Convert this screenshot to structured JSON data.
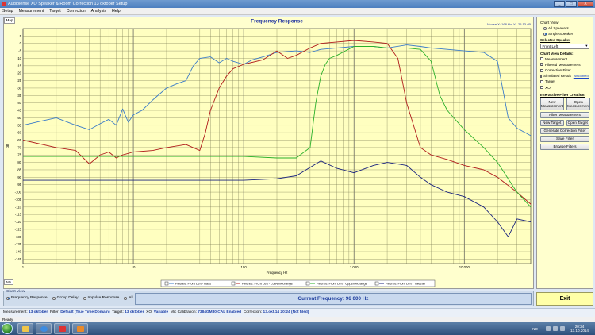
{
  "window": {
    "title": "Audiolense XO Speaker & Room Correction 13 oktober Setup",
    "controls": [
      "_",
      "□",
      "X"
    ]
  },
  "menu": [
    "Setup",
    "Measurement",
    "Target",
    "Correction",
    "Analysis",
    "Help"
  ],
  "map_tab": "Map",
  "mv_tab": "Mv",
  "chart": {
    "title": "Frequency Response",
    "mouse_readout": "Mouse X: 168 Hz,  Y: -25.13 dB",
    "legend": [
      {
        "label": "Filtered: Front Left - Bass",
        "color": "#3a7bc8"
      },
      {
        "label": "Filtered: Front Left - LowerMidrange",
        "color": "#b01c1c"
      },
      {
        "label": "Filtered: Front Left - UpperMidrange",
        "color": "#2ab02a"
      },
      {
        "label": "Filtered: Front Left - Tweeter",
        "color": "#1a237e"
      }
    ]
  },
  "chart_data": {
    "type": "line",
    "xlabel": "Frequency Hz",
    "ylabel": "dB",
    "xscale": "log",
    "xlim": [
      1,
      40000
    ],
    "ylim": [
      -148,
      10
    ],
    "x_ticks": [
      "1",
      "10",
      "100",
      "1 000",
      "10 000"
    ],
    "y_ticks": [
      "5",
      "0",
      "-5",
      "-10",
      "-15",
      "-20",
      "-25",
      "-30",
      "-35",
      "-40",
      "-45",
      "-50",
      "-55",
      "-60",
      "-65",
      "-70",
      "-75",
      "-80",
      "-85",
      "-90",
      "-95",
      "-100",
      "-105",
      "-110",
      "-115",
      "-120",
      "-125",
      "-130",
      "-135",
      "-140",
      "-145"
    ],
    "grid": true,
    "series": [
      {
        "name": "Filtered: Front Left - Bass",
        "color": "#3a7bc8",
        "points": [
          [
            1,
            -55
          ],
          [
            1.5,
            -52
          ],
          [
            2,
            -50
          ],
          [
            3,
            -55
          ],
          [
            4,
            -58
          ],
          [
            5,
            -54
          ],
          [
            6,
            -51
          ],
          [
            7,
            -55
          ],
          [
            8,
            -44
          ],
          [
            9,
            -53
          ],
          [
            10,
            -48
          ],
          [
            12,
            -45
          ],
          [
            15,
            -38
          ],
          [
            20,
            -30
          ],
          [
            25,
            -27
          ],
          [
            30,
            -25
          ],
          [
            35,
            -15
          ],
          [
            40,
            -10
          ],
          [
            50,
            -9
          ],
          [
            60,
            -13
          ],
          [
            70,
            -10
          ],
          [
            80,
            -12
          ],
          [
            100,
            -14
          ],
          [
            120,
            -11
          ],
          [
            150,
            -9
          ],
          [
            200,
            -6
          ],
          [
            300,
            -5
          ],
          [
            400,
            -6
          ],
          [
            500,
            -4
          ],
          [
            700,
            -3
          ],
          [
            1000,
            -2
          ],
          [
            1500,
            -2
          ],
          [
            2000,
            -3
          ],
          [
            3000,
            -1
          ],
          [
            4000,
            -2
          ],
          [
            5000,
            -3
          ],
          [
            7000,
            -4
          ],
          [
            10000,
            -5
          ],
          [
            15000,
            -6
          ],
          [
            20000,
            -12
          ],
          [
            25000,
            -50
          ],
          [
            30000,
            -57
          ],
          [
            40000,
            -62
          ]
        ]
      },
      {
        "name": "Filtered: Front Left - LowerMidrange",
        "color": "#b01c1c",
        "points": [
          [
            1,
            -65
          ],
          [
            2,
            -70
          ],
          [
            3,
            -72
          ],
          [
            4,
            -81
          ],
          [
            5,
            -75
          ],
          [
            6,
            -73
          ],
          [
            7,
            -77
          ],
          [
            8,
            -75
          ],
          [
            10,
            -73
          ],
          [
            15,
            -72
          ],
          [
            20,
            -70
          ],
          [
            30,
            -68
          ],
          [
            40,
            -72
          ],
          [
            45,
            -60
          ],
          [
            50,
            -45
          ],
          [
            60,
            -30
          ],
          [
            70,
            -22
          ],
          [
            80,
            -17
          ],
          [
            100,
            -14
          ],
          [
            150,
            -11
          ],
          [
            200,
            -5
          ],
          [
            250,
            -10
          ],
          [
            300,
            -8
          ],
          [
            400,
            -3
          ],
          [
            500,
            0
          ],
          [
            700,
            1
          ],
          [
            1000,
            2
          ],
          [
            1500,
            1
          ],
          [
            2000,
            0
          ],
          [
            2500,
            -10
          ],
          [
            3000,
            -40
          ],
          [
            4000,
            -70
          ],
          [
            5000,
            -75
          ],
          [
            7000,
            -78
          ],
          [
            10000,
            -82
          ],
          [
            15000,
            -85
          ],
          [
            20000,
            -90
          ],
          [
            30000,
            -100
          ],
          [
            40000,
            -108
          ]
        ]
      },
      {
        "name": "Filtered: Front Left - UpperMidrange",
        "color": "#2ab02a",
        "points": [
          [
            1,
            -76
          ],
          [
            10,
            -76
          ],
          [
            100,
            -76
          ],
          [
            200,
            -77
          ],
          [
            300,
            -77
          ],
          [
            400,
            -70
          ],
          [
            450,
            -40
          ],
          [
            500,
            -22
          ],
          [
            550,
            -14
          ],
          [
            600,
            -10
          ],
          [
            700,
            -8
          ],
          [
            1000,
            -2
          ],
          [
            1500,
            -2
          ],
          [
            2000,
            -3
          ],
          [
            3000,
            -3
          ],
          [
            4000,
            -4
          ],
          [
            5000,
            -12
          ],
          [
            6000,
            -35
          ],
          [
            7000,
            -45
          ],
          [
            10000,
            -58
          ],
          [
            15000,
            -70
          ],
          [
            20000,
            -80
          ],
          [
            30000,
            -100
          ],
          [
            40000,
            -110
          ]
        ]
      },
      {
        "name": "Filtered: Front Left - Tweeter",
        "color": "#1a237e",
        "points": [
          [
            1,
            -92
          ],
          [
            10,
            -92
          ],
          [
            100,
            -92
          ],
          [
            200,
            -91
          ],
          [
            300,
            -89
          ],
          [
            500,
            -79
          ],
          [
            700,
            -84
          ],
          [
            1000,
            -87
          ],
          [
            1500,
            -82
          ],
          [
            2000,
            -80
          ],
          [
            3000,
            -82
          ],
          [
            4000,
            -90
          ],
          [
            5000,
            -95
          ],
          [
            7000,
            -100
          ],
          [
            10000,
            -103
          ],
          [
            15000,
            -110
          ],
          [
            20000,
            -120
          ],
          [
            25000,
            -130
          ],
          [
            30000,
            -118
          ],
          [
            40000,
            -120
          ]
        ]
      }
    ]
  },
  "sidebar": {
    "chart_view_label": "Chart View",
    "radio_all": "All Speakers",
    "radio_single": "Single Speaker",
    "selected_speaker_label": "Selected Speaker",
    "speaker_value": "Front Left",
    "details_label": "Chart View Details:",
    "checks": [
      {
        "label": "Measurement",
        "checked": false
      },
      {
        "label": "Filtered Measurement",
        "checked": true
      },
      {
        "label": "Correction Filter",
        "checked": false
      },
      {
        "label": "Simulated Result",
        "checked": false
      },
      {
        "label": "Target",
        "checked": false
      },
      {
        "label": "XO",
        "checked": false
      }
    ],
    "smoothed": "(smoothed)",
    "interactive_label": "Interactive Filter Creation:",
    "new_measurement": "New Measurement",
    "open_measurement": "Open Measurement",
    "filter_measurement": "Filter Measurement",
    "new_target": "New Target",
    "open_target": "Open Target",
    "generate_filter": "Generate Correction Filter",
    "save_filter": "Save Filter",
    "browse_filters": "Browse Filters"
  },
  "bottom": {
    "chart_view_label": "Chart View",
    "options": [
      {
        "label": "Frequency Response",
        "selected": true
      },
      {
        "label": "Group Delay",
        "selected": false
      },
      {
        "label": "Impulse Response",
        "selected": false
      },
      {
        "label": "All",
        "selected": false
      }
    ],
    "current_frequency": "Current Frequency: 96 000 Hz",
    "exit": "Exit"
  },
  "info": {
    "measurement_label": "Measurement:",
    "measurement": "13 oktober",
    "filter_label": "Filter:",
    "filter": "Default (True Time Domain)",
    "target_label": "Target:",
    "target": "13 oktober",
    "xo_label": "XO:",
    "xo": "Variable",
    "mic_label": "Mic Calibration:",
    "mic": "7384GM30.CAL Enabled",
    "correction_label": "Correction:",
    "correction": "13.okt.14 20:24 (Not filed)"
  },
  "status": "Ready",
  "tray": {
    "lang": "NO",
    "time": "20:24",
    "date": "13.10.2014"
  }
}
